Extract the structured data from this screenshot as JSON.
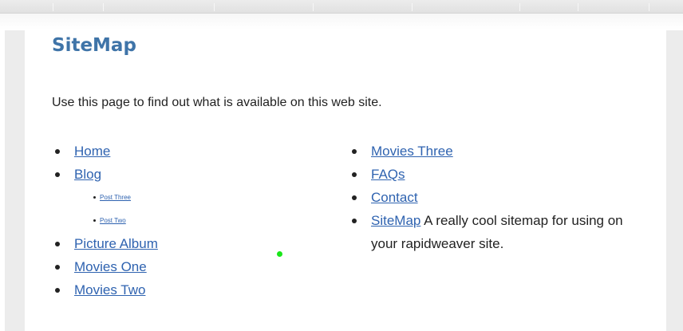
{
  "page": {
    "title": "SiteMap",
    "intro": "Use this page to find out what is available on this web site."
  },
  "sitemap": {
    "column1": [
      {
        "label": "Home"
      },
      {
        "label": "Blog",
        "children": [
          {
            "label": "Post Three"
          },
          {
            "label": "Post Two"
          }
        ]
      },
      {
        "label": "Picture Album"
      },
      {
        "label": "Movies One"
      },
      {
        "label": "Movies Two"
      }
    ],
    "column2": [
      {
        "label": "Movies Three"
      },
      {
        "label": "FAQs"
      },
      {
        "label": "Contact"
      },
      {
        "label": "SiteMap",
        "description": "A really cool sitemap for using on your rapidweaver site."
      }
    ]
  },
  "colors": {
    "title": "#3f74a8",
    "link": "#2f63b0",
    "text": "#222222",
    "cursor": "#19e619"
  }
}
